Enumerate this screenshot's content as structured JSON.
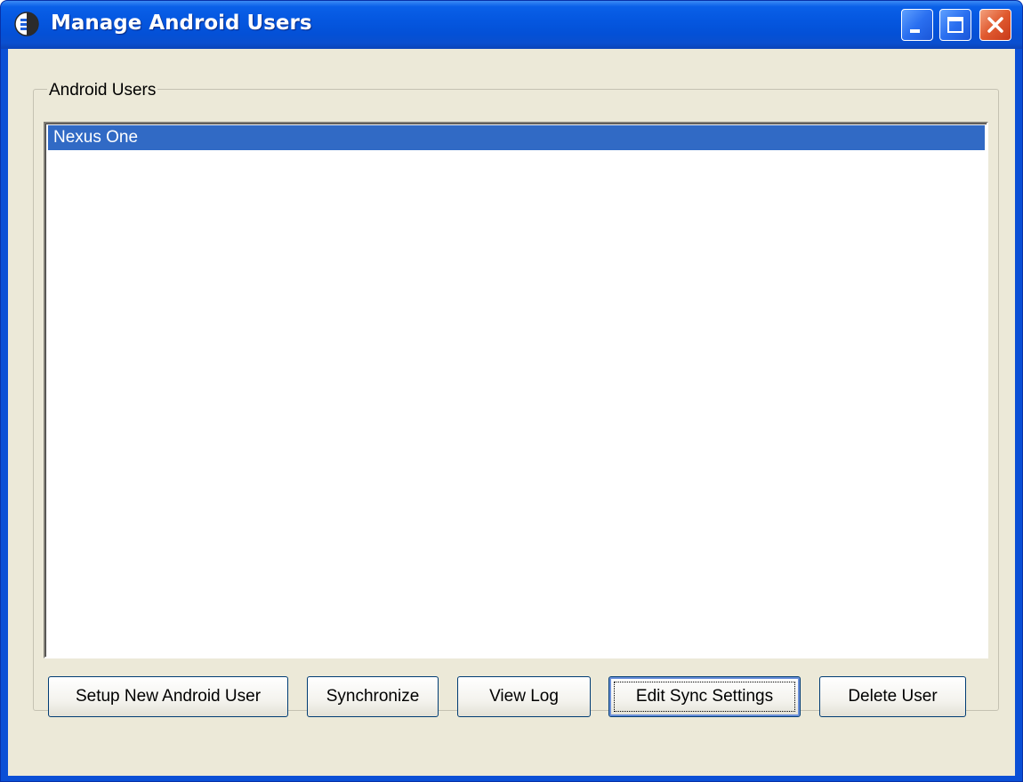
{
  "window": {
    "title": "Manage Android Users",
    "controls": {
      "minimize": "minimize",
      "maximize": "maximize",
      "close": "close"
    }
  },
  "group": {
    "label": "Android Users"
  },
  "users": [
    {
      "name": "Nexus One",
      "selected": true
    }
  ],
  "buttons": {
    "setup_new": "Setup New Android User",
    "synchronize": "Synchronize",
    "view_log": "View Log",
    "edit_sync_settings": "Edit Sync Settings",
    "delete_user": "Delete User"
  },
  "colors": {
    "selection": "#316ac5",
    "titlebar": "#0557e0",
    "client_bg": "#ece9d8"
  }
}
